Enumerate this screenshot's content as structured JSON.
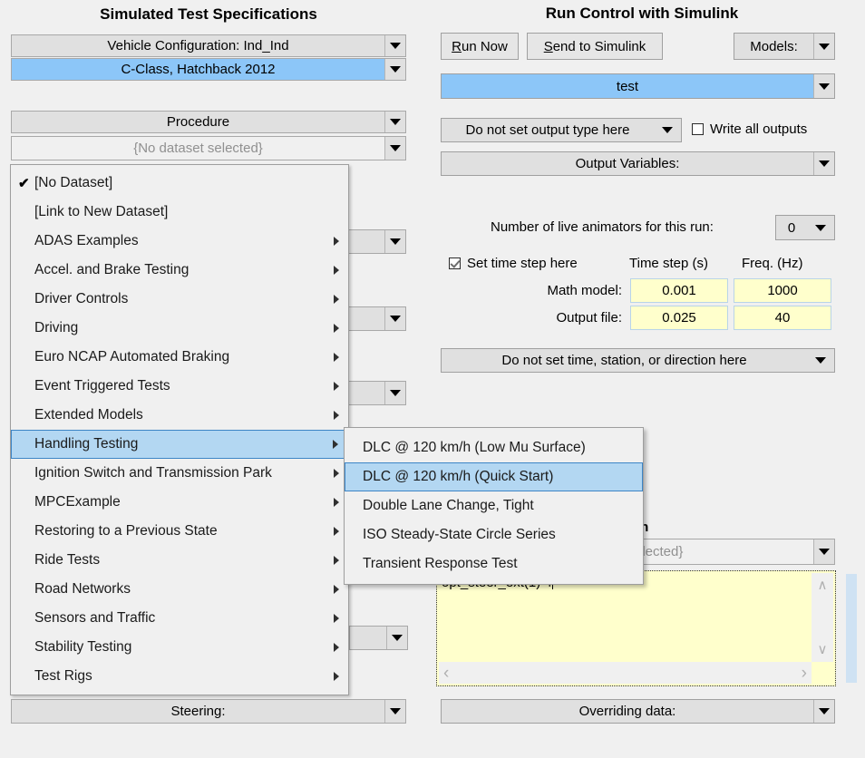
{
  "left_panel": {
    "title": "Simulated Test Specifications",
    "vehicle_config_combo": "Vehicle Configuration: Ind_Ind",
    "vehicle_value_combo": "C-Class, Hatchback 2012",
    "procedure_combo": "Procedure",
    "procedure_value_combo": "{No dataset selected}",
    "steering_combo": "Steering:"
  },
  "right_panel": {
    "title": "Run Control with Simulink",
    "run_now_button": {
      "accel": "R",
      "rest": "un Now"
    },
    "send_to_simulink_button": {
      "accel": "S",
      "rest": "end to Simulink"
    },
    "models_combo": "Models:",
    "run_name_combo": "test",
    "output_type_combo": "Do not set output type here",
    "write_all_outputs_label": "Write all outputs",
    "write_all_outputs_checked": false,
    "output_variables_combo": "Output Variables:",
    "live_animators_label": "Number of live animators for this run:",
    "live_animators_value": "0",
    "set_time_step_label": "Set time step here",
    "set_time_step_checked": true,
    "col_time_step_header": "Time step (s)",
    "col_freq_header": "Freq. (Hz)",
    "math_model_label": "Math model:",
    "math_model_time_step": "0.001",
    "math_model_freq": "1000",
    "output_file_label": "Output file:",
    "output_file_time_step": "0.025",
    "output_file_freq": "40",
    "time_station_direction_combo": "Do not set time, station, or direction here",
    "occluded_heading": "un",
    "occluded_dataset_combo": "elected}",
    "command_textarea_value": "opt_steer_ext(1) 4",
    "overriding_data_combo": "Overriding data:"
  },
  "procedure_menu": {
    "items": [
      {
        "label": "[No Dataset]",
        "checked": true,
        "submenu": false
      },
      {
        "label": "[Link to New Dataset]",
        "checked": false,
        "submenu": false
      },
      {
        "label": "ADAS Examples",
        "checked": false,
        "submenu": true
      },
      {
        "label": "Accel. and Brake Testing",
        "checked": false,
        "submenu": true
      },
      {
        "label": "Driver Controls",
        "checked": false,
        "submenu": true
      },
      {
        "label": "Driving",
        "checked": false,
        "submenu": true
      },
      {
        "label": "Euro NCAP Automated Braking",
        "checked": false,
        "submenu": true
      },
      {
        "label": "Event Triggered Tests",
        "checked": false,
        "submenu": true
      },
      {
        "label": "Extended Models",
        "checked": false,
        "submenu": true
      },
      {
        "label": "Handling Testing",
        "checked": false,
        "submenu": true,
        "selected": true
      },
      {
        "label": "Ignition Switch and Transmission Park",
        "checked": false,
        "submenu": true
      },
      {
        "label": "MPCExample",
        "checked": false,
        "submenu": true
      },
      {
        "label": "Restoring to a Previous State",
        "checked": false,
        "submenu": true
      },
      {
        "label": "Ride Tests",
        "checked": false,
        "submenu": true
      },
      {
        "label": "Road Networks",
        "checked": false,
        "submenu": true
      },
      {
        "label": "Sensors and Traffic",
        "checked": false,
        "submenu": true
      },
      {
        "label": "Stability Testing",
        "checked": false,
        "submenu": true
      },
      {
        "label": "Test Rigs",
        "checked": false,
        "submenu": true
      }
    ]
  },
  "handling_submenu": {
    "items": [
      {
        "label": "DLC @ 120 km/h (Low Mu Surface)",
        "selected": false
      },
      {
        "label": "DLC @ 120 km/h (Quick Start)",
        "selected": true
      },
      {
        "label": "Double Lane Change, Tight",
        "selected": false
      },
      {
        "label": "ISO Steady-State Circle Series",
        "selected": false
      },
      {
        "label": "Transient Response Test",
        "selected": false
      }
    ]
  },
  "colors": {
    "window_bg": "#f0f0f0",
    "combo_bg": "#e0e0e0",
    "selection_blue": "#8cc6f8",
    "menu_highlight": "#b3d7f2",
    "menu_highlight_border": "#3d85c6",
    "edit_yellow": "#ffffcc",
    "slider_thumb": "#cfe2f3"
  }
}
